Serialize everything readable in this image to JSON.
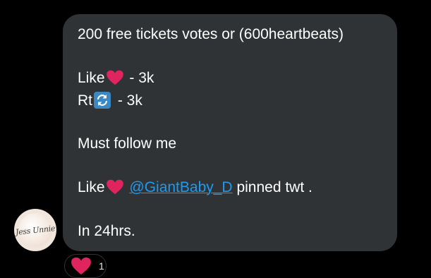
{
  "message": {
    "line1": "200 free tickets votes or (600heartbeats)",
    "like_label": "Like",
    "like_value": " - 3k",
    "rt_label": "Rt",
    "rt_value": " - 3k",
    "follow": "Must follow me",
    "pin_like_label": "Like",
    "mention": "@GiantBaby_D",
    "pin_suffix": " pinned twt .",
    "deadline": "In 24hrs."
  },
  "avatar": {
    "text": "Jess Unnie"
  },
  "reaction": {
    "emoji": "heart-icon",
    "count": "1"
  },
  "colors": {
    "bubble": "#2f3336",
    "text": "#ffffff",
    "mention": "#1d9bf0",
    "heart": "#e0245e",
    "rt_icon": "#3b88c3"
  }
}
